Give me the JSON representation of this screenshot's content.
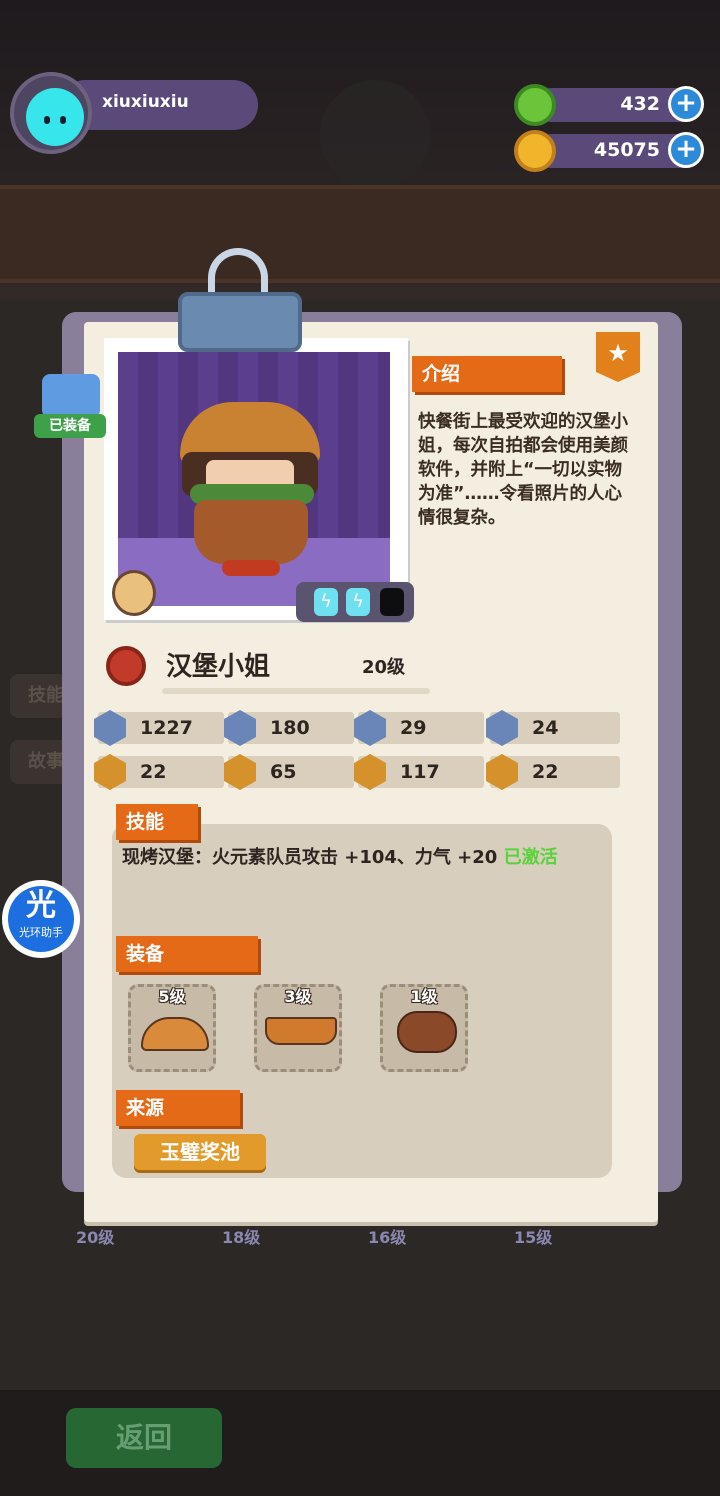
{
  "header": {
    "username": "xiuxiuxiu",
    "gems": "432",
    "coins": "45075"
  },
  "card": {
    "equipped_badge": "已装备",
    "intro_title": "介绍",
    "intro_text": "快餐街上最受欢迎的汉堡小姐，每次自拍都会使用美颜软件，并附上“一切以实物为准”……令看照片的人心情很复杂。",
    "character_name": "汉堡小姐",
    "character_level": "20级",
    "stats": [
      {
        "icon": "heart-icon",
        "value": "1227",
        "color": "#6a86b8"
      },
      {
        "icon": "attack-icon",
        "value": "180",
        "color": "#6a86b8"
      },
      {
        "icon": "defense-icon",
        "value": "29",
        "color": "#6a86b8"
      },
      {
        "icon": "anchor-icon",
        "value": "24",
        "color": "#6a86b8"
      },
      {
        "icon": "strength-icon",
        "value": "22",
        "color": "#d4912c"
      },
      {
        "icon": "charm-icon",
        "value": "65",
        "color": "#d4912c"
      },
      {
        "icon": "power-icon",
        "value": "117",
        "color": "#d4912c"
      },
      {
        "icon": "brain-icon",
        "value": "22",
        "color": "#d4912c"
      }
    ],
    "skill_title": "技能",
    "skill_text": "现烤汉堡：火元素队员攻击 +104、力气 +20 ",
    "skill_status": "已激活",
    "equip_title": "装备",
    "equipment": [
      {
        "level": "5级",
        "icon": "bun-top-icon"
      },
      {
        "level": "3级",
        "icon": "bun-bottom-icon"
      },
      {
        "level": "1级",
        "icon": "patty-icon"
      }
    ],
    "source_title": "来源",
    "source_button": "玉璧奖池"
  },
  "sidebar": {
    "halo_main": "光",
    "halo_label": "光环助手",
    "tab_skill": "技能",
    "tab_story": "故事"
  },
  "background": {
    "level_tabs": [
      "20级",
      "18级",
      "16级",
      "15级"
    ],
    "back_button": "返回"
  }
}
